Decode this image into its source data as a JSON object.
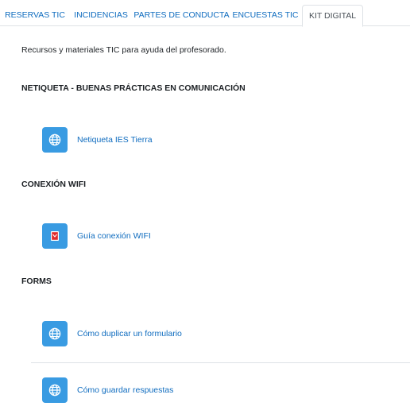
{
  "tabs": [
    {
      "label": "RESERVAS TIC",
      "active": false
    },
    {
      "label": "INCIDENCIAS",
      "active": false
    },
    {
      "label": "PARTES DE CONDUCTA",
      "active": false
    },
    {
      "label": "ENCUESTAS TIC",
      "active": false
    },
    {
      "label": "KIT DIGITAL",
      "active": true
    }
  ],
  "intro": "Recursos y materiales TIC para ayuda del profesorado.",
  "sections": [
    {
      "title": "NETIQUETA - BUENAS PRÁCTICAS EN COMUNICACIÓN",
      "activities": [
        {
          "label": "Netiqueta IES Tierra",
          "icon": "url-globe-icon"
        }
      ]
    },
    {
      "title": "CONEXIÓN WIFI",
      "activities": [
        {
          "label": "Guía conexión WIFI",
          "icon": "pdf-file-icon"
        }
      ]
    },
    {
      "title": "FORMS",
      "activities": [
        {
          "label": "Cómo duplicar un formulario",
          "icon": "url-globe-icon"
        },
        {
          "label": "Cómo guardar respuestas",
          "icon": "url-globe-icon"
        }
      ]
    }
  ],
  "colors": {
    "link": "#0f6cbf",
    "icon_bg": "#399be2",
    "active_tab_text": "#495057",
    "border": "#dee2e6",
    "pdf_red": "#e02b2b"
  }
}
